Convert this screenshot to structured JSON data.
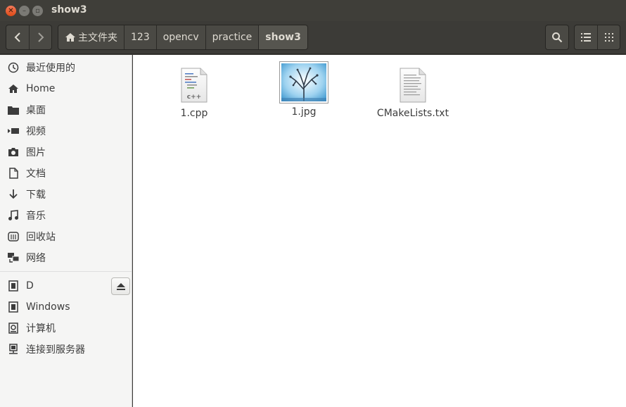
{
  "window": {
    "title": "show3"
  },
  "pathbar": {
    "crumbs": [
      {
        "label": "主文件夹"
      },
      {
        "label": "123"
      },
      {
        "label": "opencv"
      },
      {
        "label": "practice"
      },
      {
        "label": "show3"
      }
    ]
  },
  "sidebar": {
    "places": [
      {
        "label": "最近使用的",
        "icon": "recent-icon"
      },
      {
        "label": "Home",
        "icon": "home-icon"
      },
      {
        "label": "桌面",
        "icon": "folder-icon"
      },
      {
        "label": "视频",
        "icon": "video-icon"
      },
      {
        "label": "图片",
        "icon": "camera-icon"
      },
      {
        "label": "文档",
        "icon": "document-icon"
      },
      {
        "label": "下载",
        "icon": "download-icon"
      },
      {
        "label": "音乐",
        "icon": "music-icon"
      },
      {
        "label": "回收站",
        "icon": "trash-icon"
      },
      {
        "label": "网络",
        "icon": "network-icon"
      }
    ],
    "devices": [
      {
        "label": "D",
        "icon": "drive-icon"
      },
      {
        "label": "Windows",
        "icon": "drive-icon"
      },
      {
        "label": "计算机",
        "icon": "computer-icon"
      },
      {
        "label": "连接到服务器",
        "icon": "server-icon"
      }
    ]
  },
  "files": [
    {
      "name": "1.cpp",
      "icon": "cpp-file-icon",
      "badge": "c++"
    },
    {
      "name": "1.jpg",
      "icon": "image-thumbnail"
    },
    {
      "name": "CMakeLists.txt",
      "icon": "text-file-icon"
    }
  ],
  "colors": {
    "titlebar": "#3f3e39",
    "close": "#df4a16",
    "sidebar_bg": "#f5f5f4",
    "content_bg": "#ffffff"
  }
}
